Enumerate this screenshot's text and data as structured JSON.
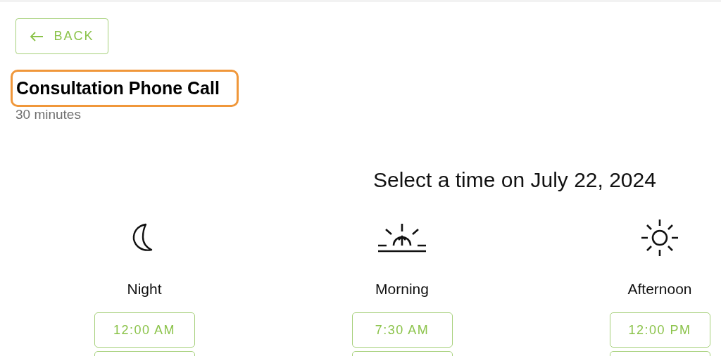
{
  "back_button": {
    "label": "BACK"
  },
  "event": {
    "title": "Consultation Phone Call",
    "highlighted": true,
    "duration": "30 minutes"
  },
  "heading": "Select a time on July 22, 2024",
  "periods": [
    {
      "kind": "night",
      "label": "Night",
      "slots": [
        "12:00 AM"
      ]
    },
    {
      "kind": "morning",
      "label": "Morning",
      "slots": [
        "7:30 AM"
      ]
    },
    {
      "kind": "afternoon",
      "label": "Afternoon",
      "slots": [
        "12:00 PM"
      ]
    }
  ]
}
